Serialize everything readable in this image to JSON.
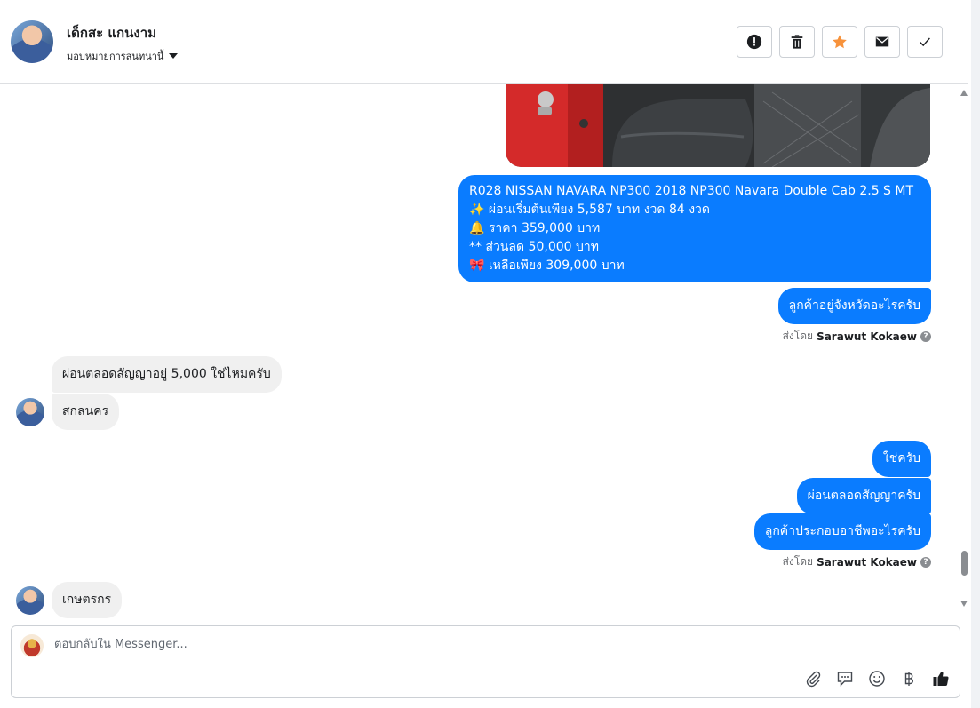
{
  "header": {
    "name": "เด็กสะ แกนงาม",
    "assign_label": "มอบหมายการสนทนานี้"
  },
  "actions": [
    {
      "icon": "alert-icon",
      "label": "Mark as spam"
    },
    {
      "icon": "trash-icon",
      "label": "Delete"
    },
    {
      "icon": "star-icon",
      "label": "Star",
      "color": "#f7923b"
    },
    {
      "icon": "envelope-icon",
      "label": "Mark unread"
    },
    {
      "icon": "check-icon",
      "label": "Done"
    }
  ],
  "messages": {
    "listing": {
      "line1": "R028 NISSAN NAVARA NP300 2018 NP300 Navara Double Cab 2.5 S MT",
      "line2": "✨ ผ่อนเริ่มต้นเพียง 5,587 บาท งวด 84 งวด",
      "line3": "🔔  ราคา 359,000 บาท",
      "line4": "** ส่วนลด 50,000 บาท",
      "line5": "🎀 เหลือเพียง 309,000 บาท"
    },
    "ask_province": "ลูกค้าอยู่จังหวัดอะไรครับ",
    "sent_by_1": {
      "prefix": "ส่งโดย",
      "name": "Sarawut Kokaew"
    },
    "in_installment": "ผ่อนตลอดสัญญาอยู่ 5,000 ใช่ไหมครับ",
    "in_province": "สกลนคร",
    "out_yes": "ใช่ครับ",
    "out_contract": "ผ่อนตลอดสัญญาครับ",
    "out_job": "ลูกค้าประกอบอาชีพอะไรครับ",
    "sent_by_2": {
      "prefix": "ส่งโดย",
      "name": "Sarawut Kokaew"
    },
    "in_job": "เกษตรกร"
  },
  "composer": {
    "placeholder": "ตอบกลับใน Messenger..."
  },
  "colors": {
    "outgoing": "#0a7cff",
    "incoming": "#f0f0f0",
    "like": "#1c1e21"
  }
}
